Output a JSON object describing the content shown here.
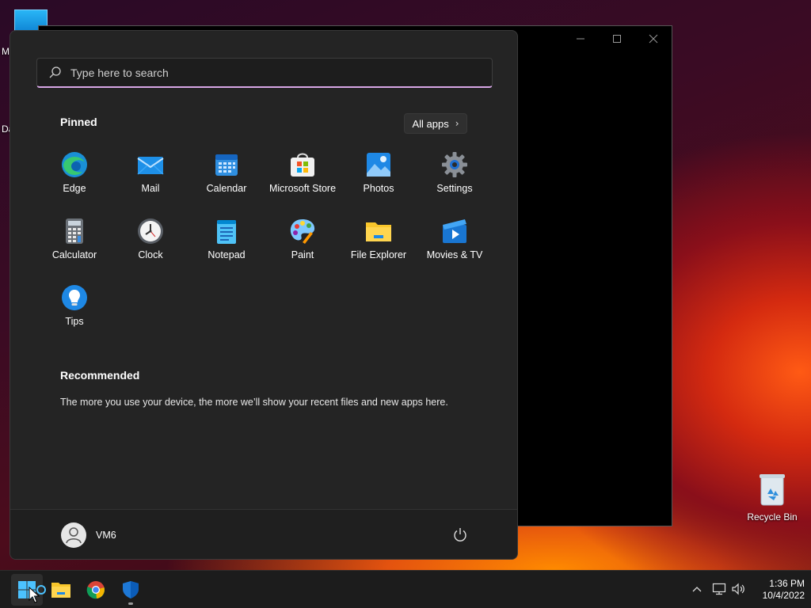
{
  "desktop": {
    "left_fragments": [
      "M",
      "Da"
    ],
    "recycle_bin_label": "Recycle Bin"
  },
  "start_menu": {
    "search": {
      "placeholder": "Type here to search"
    },
    "pinned_title": "Pinned",
    "all_apps_label": "All apps",
    "pinned_apps": [
      {
        "label": "Edge",
        "icon": "edge-icon"
      },
      {
        "label": "Mail",
        "icon": "mail-icon"
      },
      {
        "label": "Calendar",
        "icon": "calendar-icon"
      },
      {
        "label": "Microsoft Store",
        "icon": "store-icon"
      },
      {
        "label": "Photos",
        "icon": "photos-icon"
      },
      {
        "label": "Settings",
        "icon": "gear-icon"
      },
      {
        "label": "Calculator",
        "icon": "calculator-icon"
      },
      {
        "label": "Clock",
        "icon": "clock-icon"
      },
      {
        "label": "Notepad",
        "icon": "notepad-icon"
      },
      {
        "label": "Paint",
        "icon": "paint-icon"
      },
      {
        "label": "File Explorer",
        "icon": "folder-icon"
      },
      {
        "label": "Movies & TV",
        "icon": "movies-icon"
      },
      {
        "label": "Tips",
        "icon": "lightbulb-icon"
      }
    ],
    "recommended_title": "Recommended",
    "recommended_text": "The more you use your device, the more we’ll show your recent files and new apps here.",
    "user_name": "VM6"
  },
  "taskbar": {
    "time": "1:36 PM",
    "date": "10/4/2022"
  },
  "colors": {
    "start_bg": "#242424",
    "search_underline": "#d7a6e6",
    "taskbar_bg": "#1c1c1c"
  }
}
